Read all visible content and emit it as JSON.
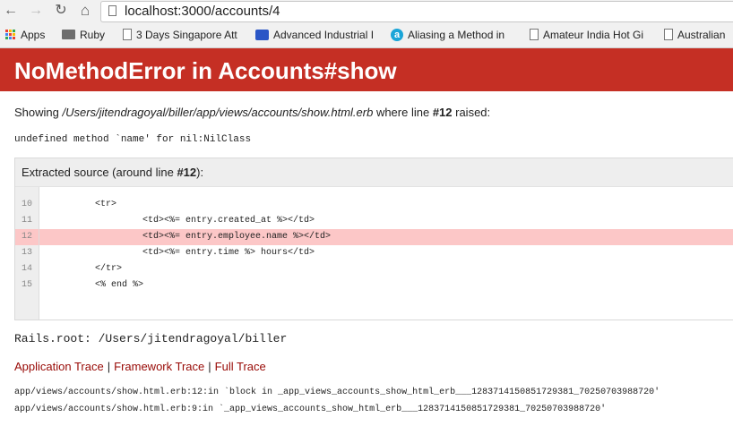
{
  "browser": {
    "url_host": "localhost",
    "url_path": ":3000/accounts/4",
    "bookmarks": [
      {
        "label": "Apps",
        "icon": "apps-grid-icon"
      },
      {
        "label": "Ruby",
        "icon": "folder-icon"
      },
      {
        "label": "3 Days Singapore Att",
        "icon": "document-icon"
      },
      {
        "label": "Advanced Industrial I",
        "icon": "calendar-flag-icon"
      },
      {
        "label": "Aliasing a Method in",
        "icon": "site-a-icon"
      },
      {
        "label": "Amateur India Hot Gi",
        "icon": "document-icon"
      },
      {
        "label": "Australian",
        "icon": "document-icon"
      }
    ]
  },
  "error": {
    "title": "NoMethodError in Accounts#show",
    "showing_prefix": "Showing ",
    "template_path": "/Users/jitendragoyal/biller/app/views/accounts/show.html.erb",
    "showing_middle": " where line ",
    "line_number": "#12",
    "showing_suffix": " raised:",
    "message": "undefined method `name' for nil:NilClass"
  },
  "source": {
    "title_prefix": "Extracted source (around line ",
    "title_line": "#12",
    "title_suffix": "):",
    "highlight_line": 12,
    "lines": [
      {
        "no": "10",
        "code": "<tr>",
        "indent": 1
      },
      {
        "no": "11",
        "code": "<td><%= entry.created_at %></td>",
        "indent": 2
      },
      {
        "no": "12",
        "code": "<td><%= entry.employee.name %></td>",
        "indent": 2
      },
      {
        "no": "13",
        "code": "<td><%= entry.time %> hours</td>",
        "indent": 2
      },
      {
        "no": "14",
        "code": "</tr>",
        "indent": 1
      },
      {
        "no": "15",
        "code": "<% end %>",
        "indent": 1
      }
    ]
  },
  "rails_root": "Rails.root: /Users/jitendragoyal/biller",
  "traces": {
    "application": "Application Trace",
    "framework": "Framework Trace",
    "full": "Full Trace",
    "separator": "|",
    "lines": [
      "app/views/accounts/show.html.erb:12:in `block in _app_views_accounts_show_html_erb___1283714150851729381_70250703988720'",
      "app/views/accounts/show.html.erb:9:in `_app_views_accounts_show_html_erb___1283714150851729381_70250703988720'"
    ]
  },
  "colors": {
    "header_bg": "#c52f24",
    "link": "#980905",
    "highlight": "#fcc7c7"
  }
}
